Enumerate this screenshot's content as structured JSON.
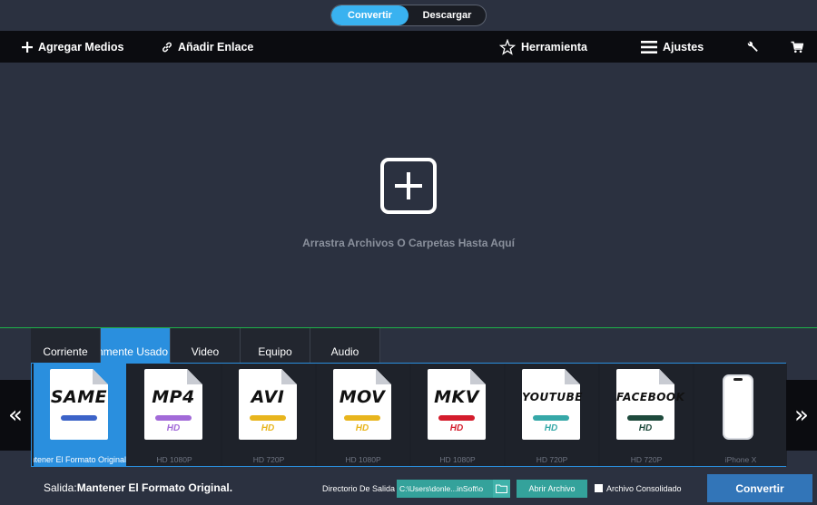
{
  "mode_switch": {
    "convert": "Convertir",
    "download": "Descargar",
    "active": "convert"
  },
  "toolbar": {
    "add_media": "Agregar Medios",
    "add_link": "Añadir Enlace",
    "tool": "Herramienta",
    "settings": "Ajustes",
    "icons": {
      "wrench": "wrench-icon",
      "cart": "cart-icon"
    }
  },
  "drop_area": {
    "text": "Arrastra Archivos O Carpetas Hasta Aquí"
  },
  "format_tabs": [
    "Corriente",
    "Comúnmente Usado",
    "Video",
    "Equipo",
    "Audio"
  ],
  "active_tab": 1,
  "formats": [
    {
      "label": "SAME",
      "sub": "",
      "caption": "Mantener El Formato Original",
      "pill_color": "#3c63c8",
      "hd_color": ""
    },
    {
      "label": "MP4",
      "sub": "HD",
      "caption": "HD 1080P",
      "pill_color": "#a26ad8",
      "hd_color": "#a26ad8"
    },
    {
      "label": "AVI",
      "sub": "HD",
      "caption": "HD 720P",
      "pill_color": "#e8b51d",
      "hd_color": "#e8b51d"
    },
    {
      "label": "MOV",
      "sub": "HD",
      "caption": "HD 1080P",
      "pill_color": "#e8b51d",
      "hd_color": "#e8b51d"
    },
    {
      "label": "MKV",
      "sub": "HD",
      "caption": "HD 1080P",
      "pill_color": "#d41c2c",
      "hd_color": "#d41c2c"
    },
    {
      "label": "YOUTUBE",
      "sub": "HD",
      "caption": "HD 720P",
      "pill_color": "#36a8a8",
      "hd_color": "#36a8a8"
    },
    {
      "label": "FACEBOOK",
      "sub": "HD",
      "caption": "HD 720P",
      "pill_color": "#1e4a3c",
      "hd_color": "#1e4a3c"
    },
    {
      "label": "",
      "sub": "",
      "caption": "iPhone X",
      "pill_color": "",
      "hd_color": ""
    }
  ],
  "bottom": {
    "output_prefix": "Salida:",
    "output_value": "Mantener El Formato Original.",
    "dir_label": "Directorio De Salida",
    "dir_value": "C:\\Users\\donle...inSoft\\o",
    "open_file": "Abrir Archivo",
    "consolidated": "Archivo Consolidado",
    "convert": "Convertir"
  },
  "colors": {
    "accent": "#39b2f0",
    "tab_active": "#2a8fde",
    "teal": "#34a29b",
    "convert": "#3275b8"
  }
}
